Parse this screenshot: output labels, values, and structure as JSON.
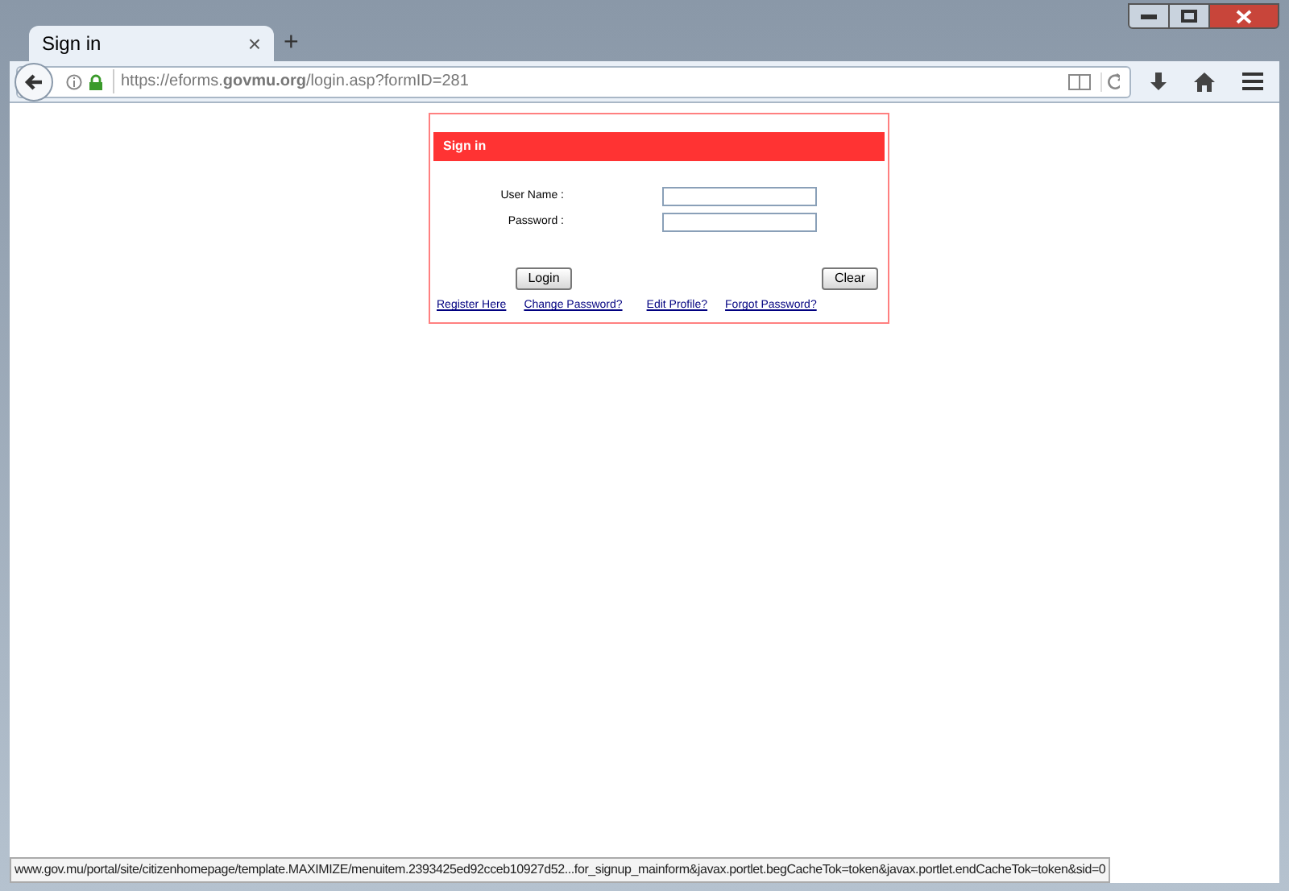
{
  "window": {
    "tab": {
      "title": "Sign in",
      "close": "×",
      "selected": true
    },
    "new_tab": "+"
  },
  "address_bar": {
    "url": "https://eforms.**govmu.org**/login.asp?formID=281"
  },
  "form": {
    "title": "Sign in",
    "fields": [
      {
        "label": "User Name :"
      },
      {
        "label": "Password :"
      }
    ],
    "buttons": [
      "Login",
      "Clear"
    ],
    "links": [
      "Register Here",
      "Change Password?",
      "Edit Profile?",
      "Forgot Password?"
    ]
  },
  "status_bar": "www.gov.mu/portal/site/citizenhomepage/template.MAXIMIZE/menuitem.2393425ed92cceb10927d52...for_signup_mainform&javax.portlet.begCacheTok=token&javax.portlet.endCacheTok=token&sid=0"
}
